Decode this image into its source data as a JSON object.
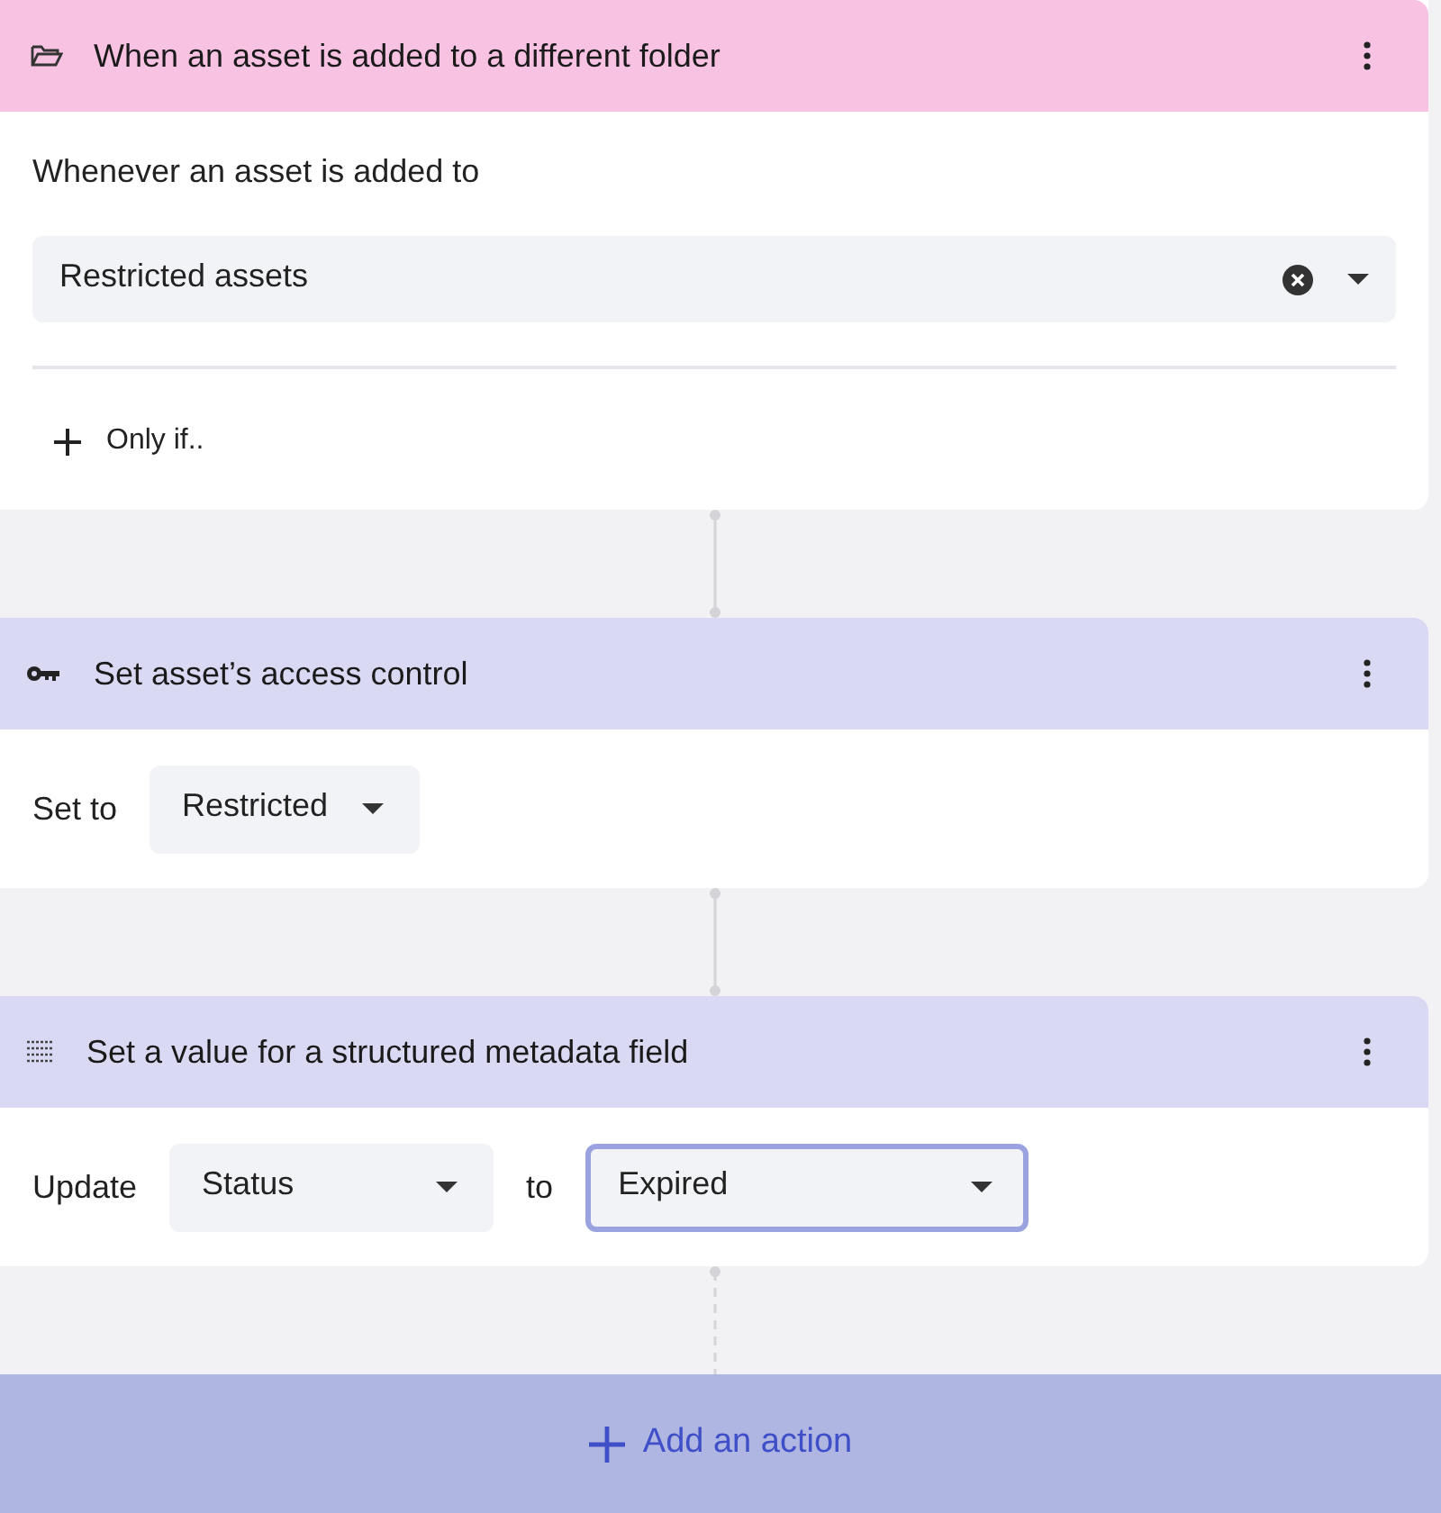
{
  "trigger": {
    "title": "When an asset is added to a different folder",
    "prompt": "Whenever an asset is added to",
    "folder": {
      "value": "Restricted assets",
      "clearable": true
    },
    "condition_button": "Only if..",
    "connector_dashed": false
  },
  "actions": [
    {
      "kind": "access",
      "title": "Set asset’s access control",
      "label": "Set to",
      "selects": [
        {
          "value": "Restricted",
          "focused": false
        }
      ],
      "connector_dashed": false
    },
    {
      "kind": "metadata",
      "title": "Set a value for a structured metadata field",
      "label": "Update",
      "joiner": "to",
      "selects": [
        {
          "value": "Status",
          "focused": false
        },
        {
          "value": "Expired",
          "focused": true
        }
      ],
      "connector_dashed": true
    }
  ],
  "add_button": "Add an action"
}
